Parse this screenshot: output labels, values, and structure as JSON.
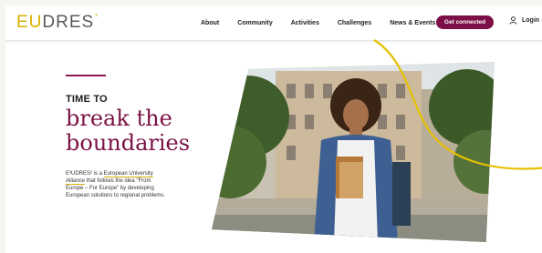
{
  "brand": {
    "logo_first": "EU",
    "logo_rest": "DRES",
    "logo_mark": "+",
    "colors": {
      "primary": "#7b0f46",
      "accent": "#d9b000"
    }
  },
  "nav": {
    "items": [
      "About",
      "Community",
      "Activities",
      "Challenges",
      "News & Events"
    ],
    "cta": "Get connected",
    "login": "Login"
  },
  "hero": {
    "kicker": "TIME TO",
    "headline_line1": "break the",
    "headline_line2": "boundaries",
    "intro_prefix": "E³UDRES² is a ",
    "intro_link": "European University Alliance",
    "intro_suffix": " that follows the idea \"From Europe – For Europe\" by developing European solutions to regional problems.",
    "image_subject": "student-holding-books-photo"
  },
  "icons": {
    "login": "user-icon"
  }
}
